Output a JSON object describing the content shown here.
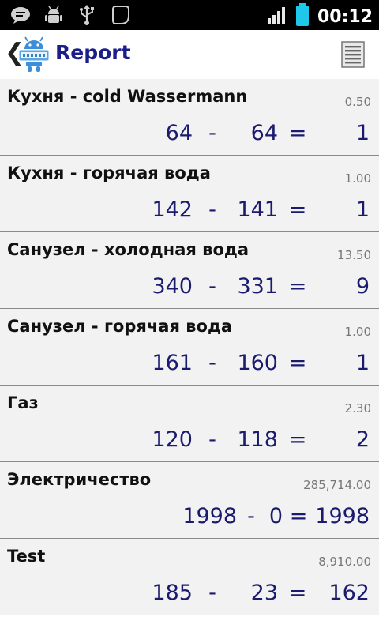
{
  "status_bar": {
    "time": "00:12",
    "icons": [
      "chat-notification-icon",
      "android-debug-icon",
      "usb-icon",
      "app-notification-icon",
      "signal-icon",
      "battery-icon"
    ]
  },
  "action_bar": {
    "title": "Report",
    "back_glyph": "❮",
    "icons": [
      "back-icon",
      "app-logo-icon",
      "menu-icon"
    ]
  },
  "colors": {
    "title": "#1b1e8a",
    "numbers": "#1a1a6e",
    "row_bg": "#f2f2f2",
    "rate": "#777777",
    "battery": "#1fc7e8"
  },
  "rows": [
    {
      "name": "Кухня - cold Wassermann",
      "rate": "0.50",
      "current": "64",
      "minus": "-",
      "previous": "64",
      "equals": "=",
      "result": "1"
    },
    {
      "name": "Кухня - горячая вода",
      "rate": "1.00",
      "current": "142",
      "minus": "-",
      "previous": "141",
      "equals": "=",
      "result": "1"
    },
    {
      "name": "Санузел - холодная вода",
      "rate": "13.50",
      "current": "340",
      "minus": "-",
      "previous": "331",
      "equals": "=",
      "result": "9"
    },
    {
      "name": "Санузел - горячая вода",
      "rate": "1.00",
      "current": "161",
      "minus": "-",
      "previous": "160",
      "equals": "=",
      "result": "1"
    },
    {
      "name": "Газ",
      "rate": "2.30",
      "current": "120",
      "minus": "-",
      "previous": "118",
      "equals": "=",
      "result": "2"
    },
    {
      "name": "Электричество",
      "rate": "285,714.00",
      "current": "1998",
      "minus": "-",
      "previous": "0",
      "equals": "=",
      "result": "1998"
    },
    {
      "name": "Test",
      "rate": "8,910.00",
      "current": "185",
      "minus": "-",
      "previous": "23",
      "equals": "=",
      "result": "162"
    }
  ]
}
